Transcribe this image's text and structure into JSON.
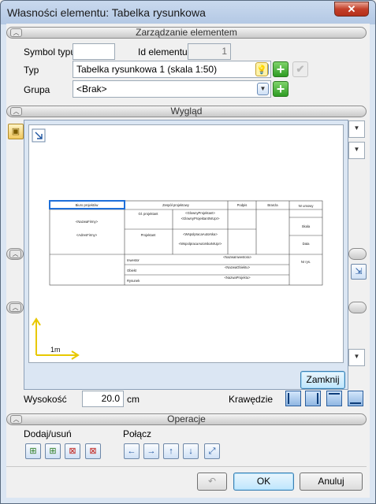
{
  "window": {
    "title": "Własności elementu: Tabelka rysunkowa",
    "close_glyph": "✕"
  },
  "sections": {
    "management": "Zarządzanie elementem",
    "appearance": "Wygląd",
    "operations": "Operacje"
  },
  "management": {
    "symbol_label": "Symbol typu",
    "symbol_value": "",
    "id_label": "Id elementu",
    "id_value": "1",
    "type_label": "Typ",
    "type_value": "Tabelka rysunkowa 1 (skala 1:50)",
    "group_label": "Grupa",
    "group_value": "<Brak>"
  },
  "preview": {
    "scale_label": "1m",
    "close_button": "Zamknij",
    "table": {
      "biuro": "Biuro projektów",
      "zespol": "Zespół projektowy",
      "podpis": "Podpis",
      "branza": "Branża",
      "nr_umowy": "Nr umowy",
      "nazwa_firmy": "<NazwaFirmy>",
      "adres_firmy": "<AdresFirmy>",
      "gl_projektant": "Gł. projektant",
      "glowny_projektant": "<GlownyProjektant>",
      "glowny_projektant_nr": "<GlownyProjektantNrUpr>",
      "projektant": "Projektant",
      "wspolpraca_autorska": "<WspolpracaAutorska>",
      "wspolpraca_autorska_nr": "<WspolpracaAutorskaNrUpr>",
      "skala": "Skala",
      "data": "Data",
      "inwestor": "Inwestor",
      "nazwa_inwestora": "<NazwaInwestora>",
      "obiekt": "Obiekt",
      "nazwa_obiektu": "<NazwaObiektu>",
      "rysunek": "Rysunek",
      "nazwa_projektu": "<NazwaProjektu>",
      "nr_rys": "Nr rys."
    }
  },
  "dimensions": {
    "height_label": "Wysokość",
    "height_value": "20.0",
    "height_unit": "cm",
    "edges_label": "Krawędzie"
  },
  "operations": {
    "add_remove_label": "Dodaj/usuń",
    "join_label": "Połącz"
  },
  "footer": {
    "ok": "OK",
    "cancel": "Anuluj"
  },
  "colors": {
    "accent": "#3c7fb1",
    "highlight": "#1e6fd9",
    "axis": "#e8c800"
  }
}
